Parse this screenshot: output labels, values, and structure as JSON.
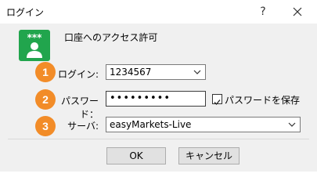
{
  "window": {
    "title": "ログイン",
    "help_label": "?"
  },
  "header": {
    "heading": "口座へのアクセス許可",
    "icon": "user-stars-icon"
  },
  "steps": [
    {
      "number": "1",
      "label": "ログイン:",
      "value": "1234567"
    },
    {
      "number": "2",
      "label": "パスワード：",
      "value": "•••••••••",
      "save_label": "パスワードを保存"
    },
    {
      "number": "3",
      "label": "サーバ:",
      "value": "easyMarkets-Live"
    }
  ],
  "buttons": {
    "ok": "OK",
    "cancel": "キャンセル"
  },
  "colors": {
    "badge": "#f28c28",
    "icon_green": "#21a54d"
  }
}
